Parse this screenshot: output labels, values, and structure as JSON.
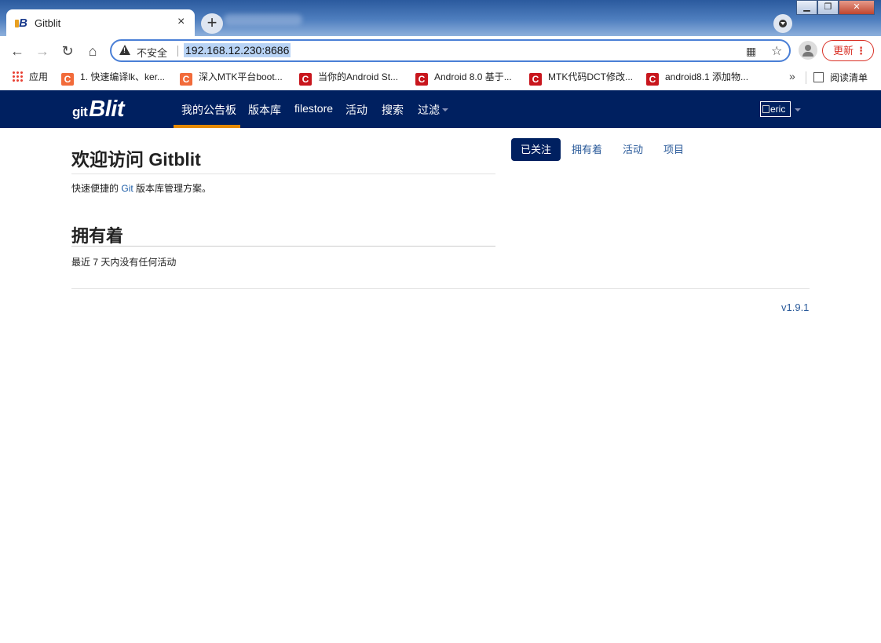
{
  "browser": {
    "tab_title": "Gitblit",
    "tab_close": "×",
    "new_tab": "+",
    "security_label": "不安全",
    "url": "192.168.12.230:8686",
    "update_label": "更新",
    "update_menu": "⋮",
    "window_minimize": "▁",
    "window_maximize": "❐",
    "window_close": "✕",
    "back": "←",
    "forward": "→",
    "reload": "↻",
    "home": "⌂",
    "qr": "▦",
    "bookmark_star": "☆"
  },
  "bookmarks": {
    "apps_label": "应用",
    "items": [
      {
        "label": "1. 快速编译lk、ker...",
        "icon": "C",
        "color": "#f26b3a"
      },
      {
        "label": "深入MTK平台boot...",
        "icon": "C",
        "color": "#f26b3a"
      },
      {
        "label": "当你的Android St...",
        "icon": "C",
        "color": "#c8161d"
      },
      {
        "label": "Android 8.0 基于...",
        "icon": "C",
        "color": "#c8161d"
      },
      {
        "label": "MTK代码DCT修改...",
        "icon": "C",
        "color": "#c8161d"
      },
      {
        "label": "android8.1 添加物...",
        "icon": "C",
        "color": "#c8161d"
      }
    ],
    "overflow": "»",
    "reading_list": "阅读清单"
  },
  "app": {
    "logo_prefix": "git",
    "logo_main": "Blit",
    "nav": {
      "dashboard": "我的公告板",
      "repositories": "版本库",
      "filestore": "filestore",
      "activity": "活动",
      "search": "搜索",
      "filters": "过滤"
    },
    "user": "eric",
    "welcome_title": "欢迎访问 Gitblit",
    "tagline_prefix": "快速便捷的",
    "tagline_link": "Git",
    "tagline_suffix": "版本库管理方案。",
    "owned_title": "拥有着",
    "no_activity": "最近 7 天内没有任何活动",
    "pills": {
      "starred": "已关注",
      "owned": "拥有着",
      "activity": "活动",
      "projects": "项目"
    },
    "version": "v1.9.1"
  },
  "colors": {
    "navbar": "#002060",
    "accent": "#e68a00",
    "link": "#2a5a9a"
  }
}
